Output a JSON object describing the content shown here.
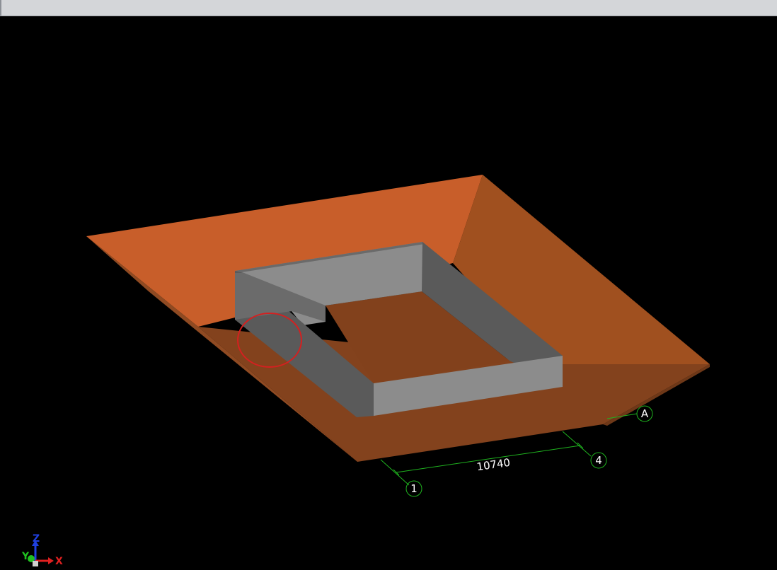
{
  "viewport": {
    "background": "#000000",
    "colors": {
      "pit_rim": "#c85e2a",
      "pit_slope_dark": "#8a4520",
      "pit_floor": "#82411c",
      "wall_light": "#8c8c8c",
      "wall_dark": "#5a5a5a",
      "grid_line": "#1fb31f",
      "selection_circle": "#d42020"
    },
    "grid_labels": {
      "grid_1": "1",
      "grid_4": "4",
      "grid_a": "A"
    },
    "dimension": {
      "value": "10740"
    },
    "view_cube_axes": {
      "x": "X",
      "y": "Y",
      "z": "Z",
      "x_color": "#e02020",
      "y_color": "#20c020",
      "z_color": "#2040e0"
    }
  }
}
